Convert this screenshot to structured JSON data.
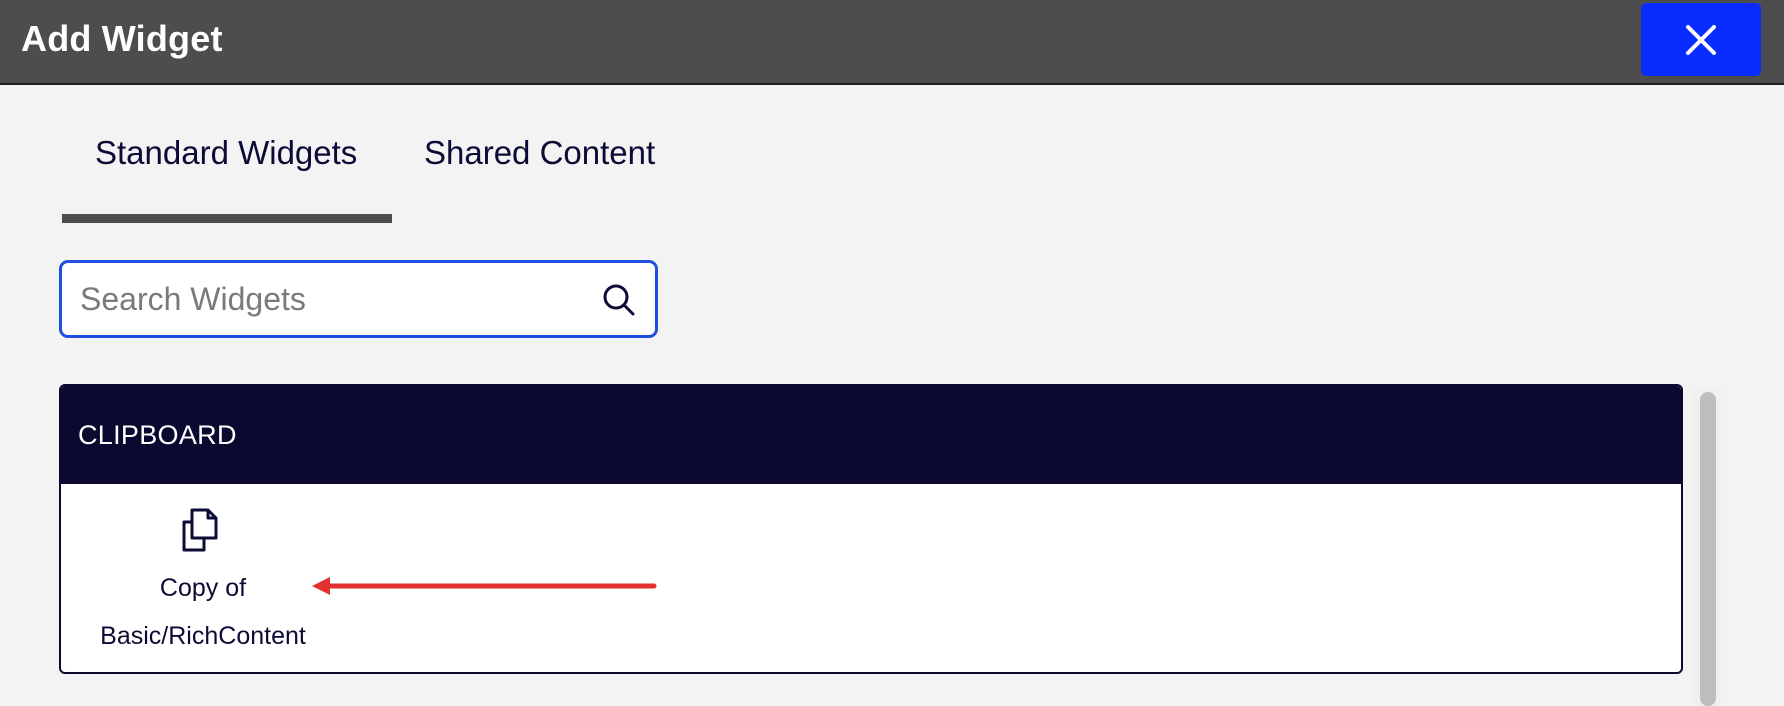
{
  "dialog": {
    "title": "Add Widget",
    "close_icon": "close-icon",
    "accent_color": "#0a2cff"
  },
  "tabs": [
    {
      "label": "Standard Widgets",
      "active": true
    },
    {
      "label": "Shared Content",
      "active": false
    }
  ],
  "search": {
    "placeholder": "Search Widgets",
    "value": "",
    "icon": "search-icon"
  },
  "clipboard": {
    "header": "CLIPBOARD",
    "header_color": "#0b0930",
    "items": [
      {
        "label_line1": "Copy of",
        "label_line2": "Basic/RichContent",
        "icon": "copy-icon"
      }
    ]
  },
  "annotation": {
    "icon": "arrow-left-icon",
    "color": "#e03030"
  }
}
